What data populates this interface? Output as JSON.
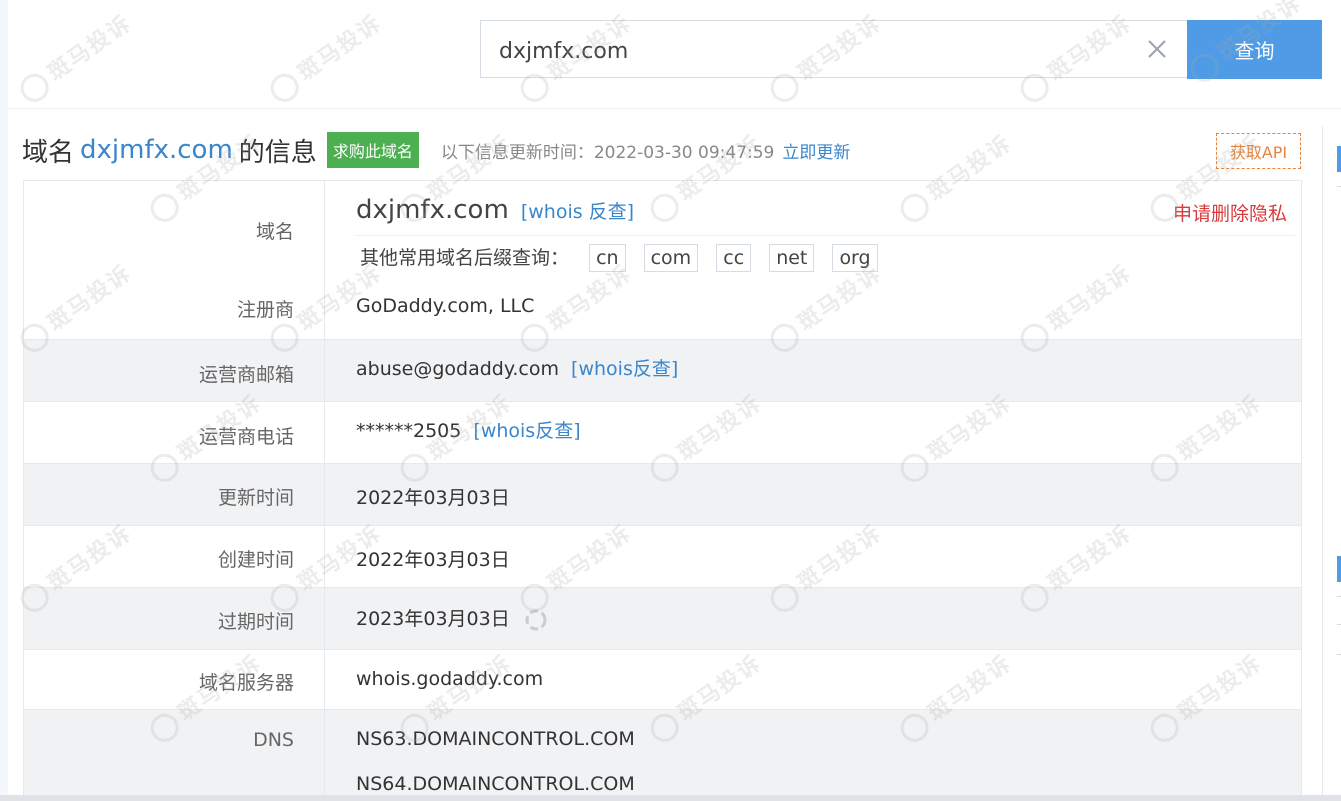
{
  "search": {
    "value": "dxjmfx.com",
    "button_label": "查询"
  },
  "header": {
    "prefix": "域名",
    "domain": "dxjmfx.com",
    "suffix": "的信息",
    "buy_label": "求购此域名",
    "update_label": "以下信息更新时间：2022-03-30 09:47:59",
    "update_link": "立即更新",
    "api_label": "获取API"
  },
  "domain_row": {
    "label": "域名",
    "domain": "dxjmfx.com",
    "whois_link": "[whois 反查]",
    "privacy_label": "申请删除隐私",
    "tld_prompt": "其他常用域名后缀查询：",
    "tlds": [
      "cn",
      "com",
      "cc",
      "net",
      "org"
    ]
  },
  "rows": {
    "registrar": {
      "label": "注册商",
      "value": "GoDaddy.com, LLC"
    },
    "email": {
      "label": "运营商邮箱",
      "value": "abuse@godaddy.com",
      "link": "[whois反查]"
    },
    "phone": {
      "label": "运营商电话",
      "value": "******2505",
      "link": "[whois反查]"
    },
    "updated": {
      "label": "更新时间",
      "value": "2022年03月03日"
    },
    "created": {
      "label": "创建时间",
      "value": "2022年03月03日"
    },
    "expires": {
      "label": "过期时间",
      "value": "2023年03月03日"
    },
    "whois_server": {
      "label": "域名服务器",
      "value": "whois.godaddy.com"
    },
    "dns": {
      "label": "DNS",
      "values": [
        "NS63.DOMAINCONTROL.COM",
        "NS64.DOMAINCONTROL.COM"
      ]
    }
  },
  "watermark": {
    "text": "斑马投诉"
  },
  "colors": {
    "link": "#3a86cc",
    "search_button": "#4f9be6",
    "buy_button": "#4caf50",
    "api": "#e8843a",
    "privacy": "#d83b3b"
  }
}
